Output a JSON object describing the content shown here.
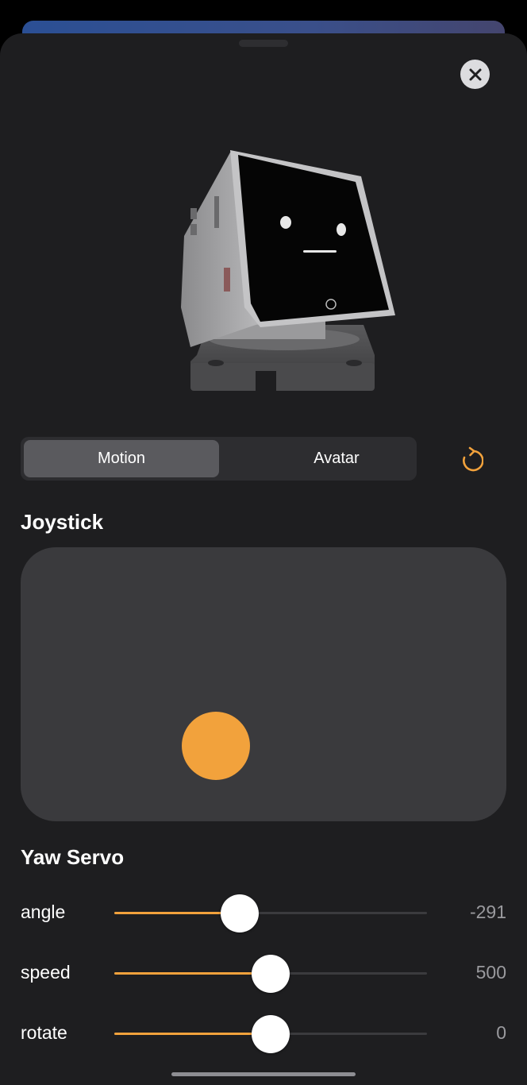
{
  "tabs": [
    {
      "label": "Motion",
      "active": true
    },
    {
      "label": "Avatar",
      "active": false
    }
  ],
  "icons": {
    "close": "close-icon",
    "refresh": "refresh-icon"
  },
  "joystick": {
    "title": "Joystick"
  },
  "yaw_servo": {
    "title": "Yaw Servo",
    "sliders": [
      {
        "label": "angle",
        "value": "-291",
        "fill_fraction": 0.4
      },
      {
        "label": "speed",
        "value": "500",
        "fill_fraction": 0.5
      },
      {
        "label": "rotate",
        "value": "0",
        "fill_fraction": 0.5
      }
    ]
  },
  "colors": {
    "accent": "#f2a23c",
    "sheet_bg": "#1e1e20",
    "pad_bg": "#3a3a3d"
  }
}
